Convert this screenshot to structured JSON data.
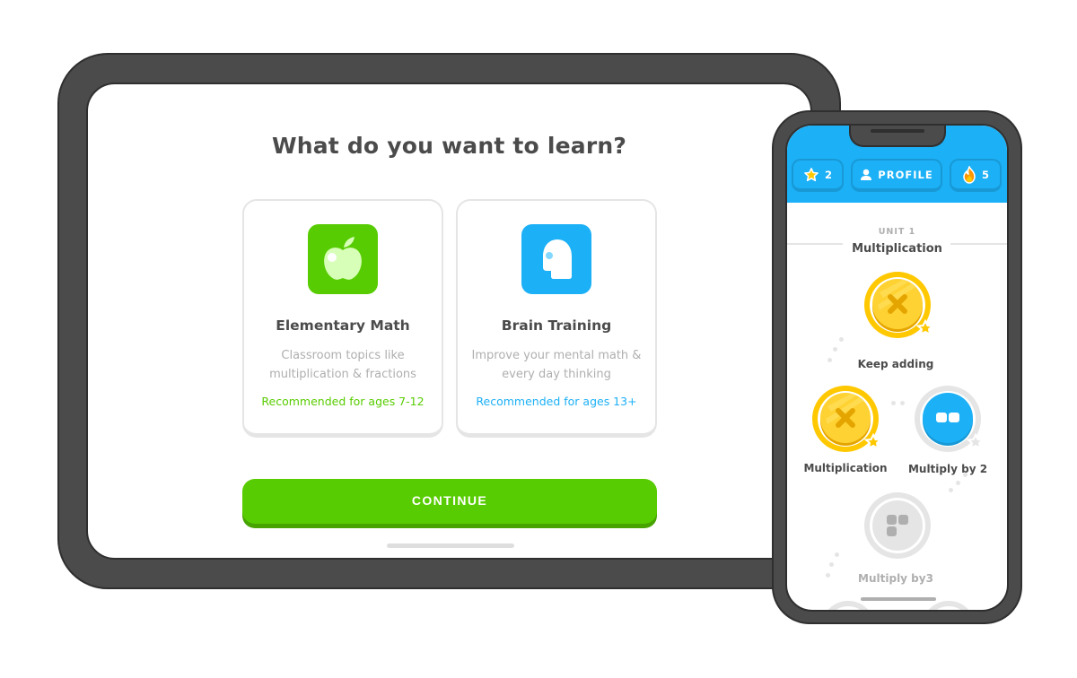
{
  "tablet": {
    "title": "What do you want to learn?",
    "courses": [
      {
        "name": "Elementary Math",
        "description": "Classroom topics like multiplication & fractions",
        "recommendation": "Recommended for ages 7-12",
        "icon": "apple-icon",
        "accent_color": "#58cc02"
      },
      {
        "name": "Brain Training",
        "description": "Improve your mental math & every day thinking",
        "recommendation": "Recommended for ages 13+",
        "icon": "head-icon",
        "accent_color": "#1cb0f6"
      }
    ],
    "continue_label": "CONTINUE"
  },
  "phone": {
    "header": {
      "stars": "2",
      "profile_label": "PROFILE",
      "streak": "5"
    },
    "unit": {
      "label": "UNIT 1",
      "title": "Multiplication"
    },
    "lessons": [
      {
        "label": "Keep adding",
        "state": "completed",
        "icon": "multiply-icon"
      },
      {
        "label": "Multiplication",
        "state": "completed",
        "icon": "multiply-icon"
      },
      {
        "label": "Multiply by 2",
        "state": "active",
        "icon": "pair-blocks-icon"
      },
      {
        "label": "Multiply  by3",
        "state": "locked",
        "icon": "three-blocks-icon"
      }
    ]
  },
  "colors": {
    "green": "#58cc02",
    "blue": "#1cb0f6",
    "gold": "#ffc800",
    "gray_text": "#afafaf",
    "dark_text": "#4b4b4b"
  }
}
